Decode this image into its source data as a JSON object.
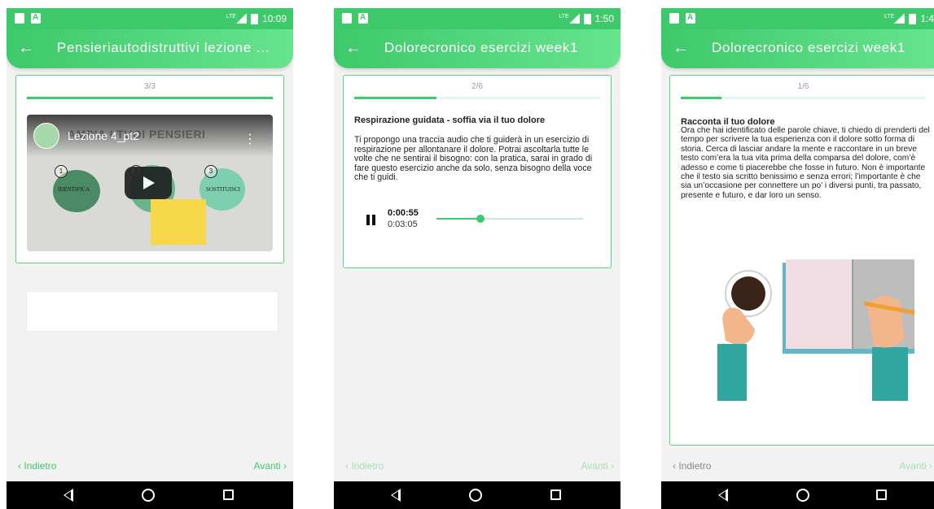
{
  "colors": {
    "accent": "#3ec96a",
    "accent_light": "#66e48e",
    "border": "#57d47d",
    "sticky_note": "#f6d84a"
  },
  "screens": [
    {
      "status": {
        "time": "10:09"
      },
      "appbar": {
        "title": "Pensieriautodistruttivi lezione …"
      },
      "card": {
        "step": "3/3",
        "progress": 1.0,
        "video": {
          "title": "Lezione 4_pt2",
          "slide_title": "AMPIA I TUOI PENSIERI",
          "steps": [
            "1",
            "2",
            "3"
          ],
          "labels": [
            "IDENTIFICA",
            "SOSTITUISCI"
          ]
        }
      },
      "nav": {
        "prev": "Indietro",
        "next": "Avanti"
      }
    },
    {
      "status": {
        "time": "1:50"
      },
      "appbar": {
        "title": "Dolorecronico esercizi week1"
      },
      "card": {
        "step": "2/6",
        "progress": 0.333,
        "section_title": "Respirazione guidata - soffia via il tuo dolore",
        "body": "Ti propongo una traccia audio che ti guiderà in un esercizio di respirazione per allontanare il dolore. Potrai ascoltarla tutte le volte che ne sentirai il bisogno: con la pratica, sarai in grado di fare questo esercizio anche da solo, senza bisogno della voce che ti guidi.",
        "audio": {
          "current": "0:00:55",
          "total": "0:03:05",
          "progress": 0.3
        }
      },
      "nav": {
        "prev": "Indietro",
        "next": "Avanti"
      }
    },
    {
      "status": {
        "time": "1:4"
      },
      "appbar": {
        "title": "Dolorecronico esercizi week1"
      },
      "card": {
        "step": "1/6",
        "progress": 0.167,
        "section_title": "Racconta il tuo dolore",
        "body": "Ora che hai identificato delle parole chiave, ti chiedo di prenderti del tempo per scrivere la tua esperienza con il dolore sotto forma di storia. Cerca di lasciar andare la mente e raccontare in un breve testo com’era la tua vita prima della comparsa del dolore, com’è adesso e come ti piacerebbe che fosse in futuro. Non è importante che il testo sia scritto benissimo e senza errori; l’importante è che sia un’occasione per  connettere un po’ i diversi punti, tra passato, presente e futuro, e dar loro un senso."
      },
      "nav": {
        "prev": "Indietro",
        "next": "Avanti"
      }
    }
  ]
}
